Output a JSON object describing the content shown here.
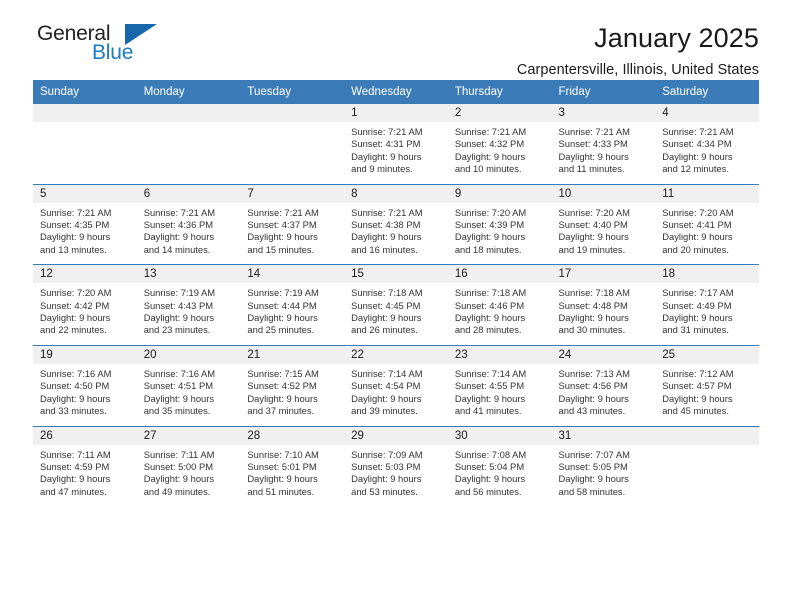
{
  "brand": {
    "name_part1": "General",
    "name_part2": "Blue",
    "triangle_icon": "triangle-icon",
    "accent_color": "#1668ab"
  },
  "header": {
    "title": "January 2025",
    "subtitle": "Carpentersville, Illinois, United States"
  },
  "calendar": {
    "header_bg": "#3b7cb8",
    "daynum_bg": "#f0f0f0",
    "weekday_headers": [
      "Sunday",
      "Monday",
      "Tuesday",
      "Wednesday",
      "Thursday",
      "Friday",
      "Saturday"
    ],
    "weeks": [
      [
        {
          "day": "",
          "sunrise": "",
          "sunset": "",
          "daylight1": "",
          "daylight2": ""
        },
        {
          "day": "",
          "sunrise": "",
          "sunset": "",
          "daylight1": "",
          "daylight2": ""
        },
        {
          "day": "",
          "sunrise": "",
          "sunset": "",
          "daylight1": "",
          "daylight2": ""
        },
        {
          "day": "1",
          "sunrise": "Sunrise: 7:21 AM",
          "sunset": "Sunset: 4:31 PM",
          "daylight1": "Daylight: 9 hours",
          "daylight2": "and 9 minutes."
        },
        {
          "day": "2",
          "sunrise": "Sunrise: 7:21 AM",
          "sunset": "Sunset: 4:32 PM",
          "daylight1": "Daylight: 9 hours",
          "daylight2": "and 10 minutes."
        },
        {
          "day": "3",
          "sunrise": "Sunrise: 7:21 AM",
          "sunset": "Sunset: 4:33 PM",
          "daylight1": "Daylight: 9 hours",
          "daylight2": "and 11 minutes."
        },
        {
          "day": "4",
          "sunrise": "Sunrise: 7:21 AM",
          "sunset": "Sunset: 4:34 PM",
          "daylight1": "Daylight: 9 hours",
          "daylight2": "and 12 minutes."
        }
      ],
      [
        {
          "day": "5",
          "sunrise": "Sunrise: 7:21 AM",
          "sunset": "Sunset: 4:35 PM",
          "daylight1": "Daylight: 9 hours",
          "daylight2": "and 13 minutes."
        },
        {
          "day": "6",
          "sunrise": "Sunrise: 7:21 AM",
          "sunset": "Sunset: 4:36 PM",
          "daylight1": "Daylight: 9 hours",
          "daylight2": "and 14 minutes."
        },
        {
          "day": "7",
          "sunrise": "Sunrise: 7:21 AM",
          "sunset": "Sunset: 4:37 PM",
          "daylight1": "Daylight: 9 hours",
          "daylight2": "and 15 minutes."
        },
        {
          "day": "8",
          "sunrise": "Sunrise: 7:21 AM",
          "sunset": "Sunset: 4:38 PM",
          "daylight1": "Daylight: 9 hours",
          "daylight2": "and 16 minutes."
        },
        {
          "day": "9",
          "sunrise": "Sunrise: 7:20 AM",
          "sunset": "Sunset: 4:39 PM",
          "daylight1": "Daylight: 9 hours",
          "daylight2": "and 18 minutes."
        },
        {
          "day": "10",
          "sunrise": "Sunrise: 7:20 AM",
          "sunset": "Sunset: 4:40 PM",
          "daylight1": "Daylight: 9 hours",
          "daylight2": "and 19 minutes."
        },
        {
          "day": "11",
          "sunrise": "Sunrise: 7:20 AM",
          "sunset": "Sunset: 4:41 PM",
          "daylight1": "Daylight: 9 hours",
          "daylight2": "and 20 minutes."
        }
      ],
      [
        {
          "day": "12",
          "sunrise": "Sunrise: 7:20 AM",
          "sunset": "Sunset: 4:42 PM",
          "daylight1": "Daylight: 9 hours",
          "daylight2": "and 22 minutes."
        },
        {
          "day": "13",
          "sunrise": "Sunrise: 7:19 AM",
          "sunset": "Sunset: 4:43 PM",
          "daylight1": "Daylight: 9 hours",
          "daylight2": "and 23 minutes."
        },
        {
          "day": "14",
          "sunrise": "Sunrise: 7:19 AM",
          "sunset": "Sunset: 4:44 PM",
          "daylight1": "Daylight: 9 hours",
          "daylight2": "and 25 minutes."
        },
        {
          "day": "15",
          "sunrise": "Sunrise: 7:18 AM",
          "sunset": "Sunset: 4:45 PM",
          "daylight1": "Daylight: 9 hours",
          "daylight2": "and 26 minutes."
        },
        {
          "day": "16",
          "sunrise": "Sunrise: 7:18 AM",
          "sunset": "Sunset: 4:46 PM",
          "daylight1": "Daylight: 9 hours",
          "daylight2": "and 28 minutes."
        },
        {
          "day": "17",
          "sunrise": "Sunrise: 7:18 AM",
          "sunset": "Sunset: 4:48 PM",
          "daylight1": "Daylight: 9 hours",
          "daylight2": "and 30 minutes."
        },
        {
          "day": "18",
          "sunrise": "Sunrise: 7:17 AM",
          "sunset": "Sunset: 4:49 PM",
          "daylight1": "Daylight: 9 hours",
          "daylight2": "and 31 minutes."
        }
      ],
      [
        {
          "day": "19",
          "sunrise": "Sunrise: 7:16 AM",
          "sunset": "Sunset: 4:50 PM",
          "daylight1": "Daylight: 9 hours",
          "daylight2": "and 33 minutes."
        },
        {
          "day": "20",
          "sunrise": "Sunrise: 7:16 AM",
          "sunset": "Sunset: 4:51 PM",
          "daylight1": "Daylight: 9 hours",
          "daylight2": "and 35 minutes."
        },
        {
          "day": "21",
          "sunrise": "Sunrise: 7:15 AM",
          "sunset": "Sunset: 4:52 PM",
          "daylight1": "Daylight: 9 hours",
          "daylight2": "and 37 minutes."
        },
        {
          "day": "22",
          "sunrise": "Sunrise: 7:14 AM",
          "sunset": "Sunset: 4:54 PM",
          "daylight1": "Daylight: 9 hours",
          "daylight2": "and 39 minutes."
        },
        {
          "day": "23",
          "sunrise": "Sunrise: 7:14 AM",
          "sunset": "Sunset: 4:55 PM",
          "daylight1": "Daylight: 9 hours",
          "daylight2": "and 41 minutes."
        },
        {
          "day": "24",
          "sunrise": "Sunrise: 7:13 AM",
          "sunset": "Sunset: 4:56 PM",
          "daylight1": "Daylight: 9 hours",
          "daylight2": "and 43 minutes."
        },
        {
          "day": "25",
          "sunrise": "Sunrise: 7:12 AM",
          "sunset": "Sunset: 4:57 PM",
          "daylight1": "Daylight: 9 hours",
          "daylight2": "and 45 minutes."
        }
      ],
      [
        {
          "day": "26",
          "sunrise": "Sunrise: 7:11 AM",
          "sunset": "Sunset: 4:59 PM",
          "daylight1": "Daylight: 9 hours",
          "daylight2": "and 47 minutes."
        },
        {
          "day": "27",
          "sunrise": "Sunrise: 7:11 AM",
          "sunset": "Sunset: 5:00 PM",
          "daylight1": "Daylight: 9 hours",
          "daylight2": "and 49 minutes."
        },
        {
          "day": "28",
          "sunrise": "Sunrise: 7:10 AM",
          "sunset": "Sunset: 5:01 PM",
          "daylight1": "Daylight: 9 hours",
          "daylight2": "and 51 minutes."
        },
        {
          "day": "29",
          "sunrise": "Sunrise: 7:09 AM",
          "sunset": "Sunset: 5:03 PM",
          "daylight1": "Daylight: 9 hours",
          "daylight2": "and 53 minutes."
        },
        {
          "day": "30",
          "sunrise": "Sunrise: 7:08 AM",
          "sunset": "Sunset: 5:04 PM",
          "daylight1": "Daylight: 9 hours",
          "daylight2": "and 56 minutes."
        },
        {
          "day": "31",
          "sunrise": "Sunrise: 7:07 AM",
          "sunset": "Sunset: 5:05 PM",
          "daylight1": "Daylight: 9 hours",
          "daylight2": "and 58 minutes."
        },
        {
          "day": "",
          "sunrise": "",
          "sunset": "",
          "daylight1": "",
          "daylight2": ""
        }
      ]
    ]
  }
}
